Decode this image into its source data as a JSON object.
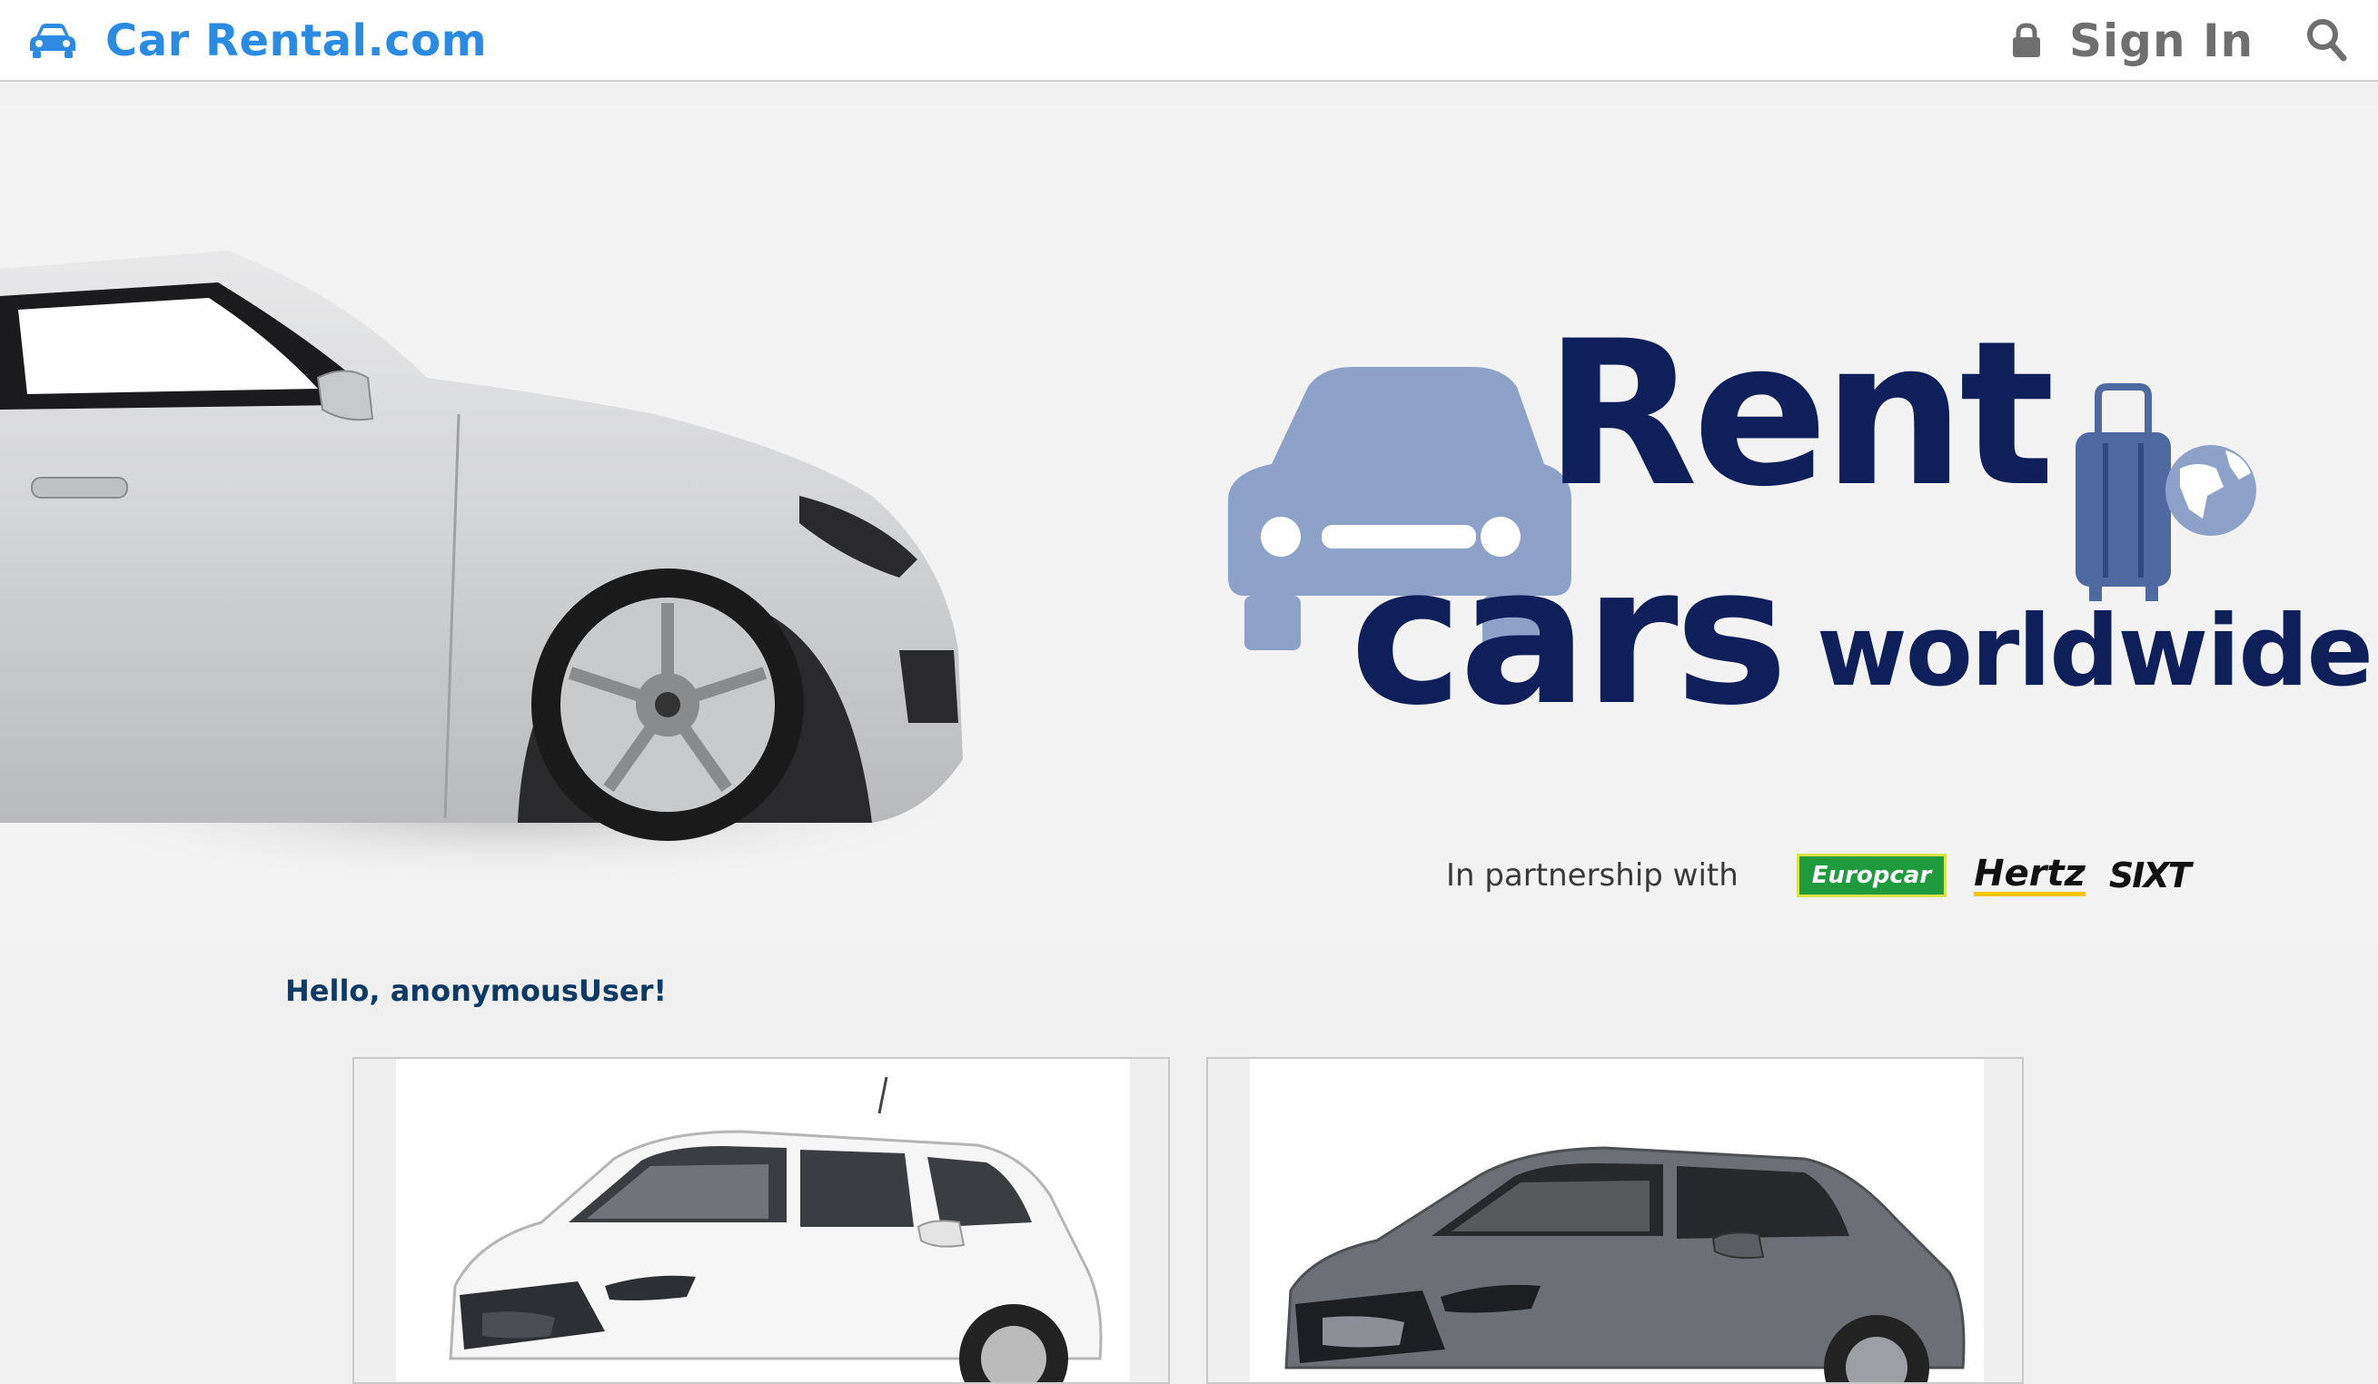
{
  "nav": {
    "brand": "Car Rental.com",
    "signin_label": "Sign In",
    "icons": [
      "car-icon",
      "lock-icon",
      "search-icon"
    ],
    "brand_color": "#2b8ae2"
  },
  "hero": {
    "headline_rent": "Rent",
    "headline_cars": "cars",
    "headline_worldwide": "worldwide",
    "partnership_text": "In partnership with",
    "partners": [
      "Europcar",
      "Hertz",
      "SIXT"
    ],
    "headline_color": "#0f1f5a"
  },
  "greeting": "Hello, anonymousUser!",
  "cars": [
    {
      "color": "white"
    },
    {
      "color": "gray"
    }
  ]
}
